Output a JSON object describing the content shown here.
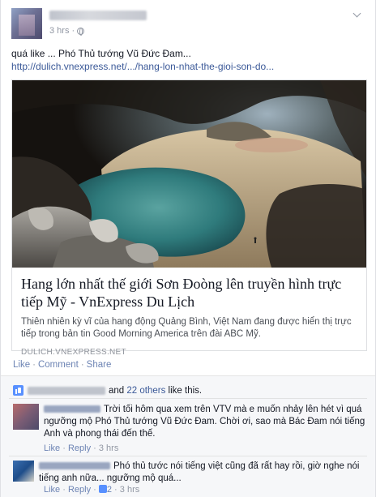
{
  "post": {
    "time": "3 hrs",
    "message_prefix": "quá like ... Phó Thủ tướng Vũ Đức Đam...",
    "message_link": "http://dulich.vnexpress.net/.../hang-lon-nhat-the-gioi-son-do..."
  },
  "link_card": {
    "title": "Hang lớn nhất thế giới Sơn Đoòng lên truyền hình trực tiếp Mỹ - VnExpress Du Lịch",
    "description": "Thiên nhiên kỳ vĩ của hang động Quảng Bình, Việt Nam đang được hiển thị trực tiếp trong bản tin Good Morning America trên đài ABC Mỹ.",
    "domain": "DULICH.VNEXPRESS.NET"
  },
  "actions": {
    "like": "Like",
    "comment": "Comment",
    "share": "Share"
  },
  "likes_summary": {
    "and": "and",
    "others": "22 others",
    "suffix": "like this."
  },
  "comments": [
    {
      "text": "Trời tối hôm qua xem trên VTV mà e muốn nhảy lên hét vì quá ngưỡng mộ Phó Thủ tướng Vũ Đức Đam. Chời ơi, sao mà Bác Đam nói tiếng Anh và phong thái đến thế.",
      "like": "Like",
      "reply": "Reply",
      "time": "3 hrs",
      "like_count": ""
    },
    {
      "text": "Phó thủ tước nói tiếng việt cũng đã rất hay rồi, giờ nghe nói tiếng anh nữa... ngưỡng mộ quá...",
      "like": "Like",
      "reply": "Reply",
      "time": "3 hrs",
      "like_count": "2"
    }
  ],
  "colors": {
    "link": "#3b5998",
    "action_link": "#6d84b4",
    "meta": "#9197a3",
    "ufi_bg": "#f6f7f9"
  }
}
